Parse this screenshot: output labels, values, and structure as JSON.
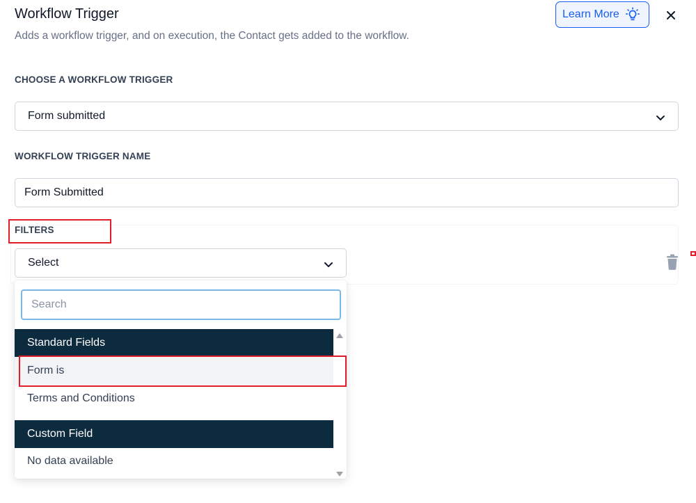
{
  "header": {
    "title": "Workflow Trigger",
    "subtitle": "Adds a workflow trigger, and on execution, the Contact gets added to the workflow.",
    "learn_more_label": "Learn More"
  },
  "trigger": {
    "section_label": "CHOOSE A WORKFLOW TRIGGER",
    "selected_value": "Form submitted"
  },
  "trigger_name": {
    "section_label": "WORKFLOW TRIGGER NAME",
    "value": "Form Submitted"
  },
  "filters": {
    "section_label": "FILTERS",
    "select_value": "Select",
    "dropdown": {
      "search_placeholder": "Search",
      "groups": [
        {
          "header": "Standard Fields",
          "options": [
            "Form is",
            "Terms and Conditions"
          ]
        },
        {
          "header": "Custom Field",
          "options": [
            "No data available"
          ]
        }
      ]
    }
  },
  "colors": {
    "accent": "#155eef",
    "group_header_bg": "#0c2b3f",
    "highlight": "#e11d2a"
  },
  "icons": [
    "lightbulb-icon",
    "close-icon",
    "chevron-down-icon",
    "trash-icon",
    "scroll-up-icon",
    "scroll-down-icon"
  ]
}
